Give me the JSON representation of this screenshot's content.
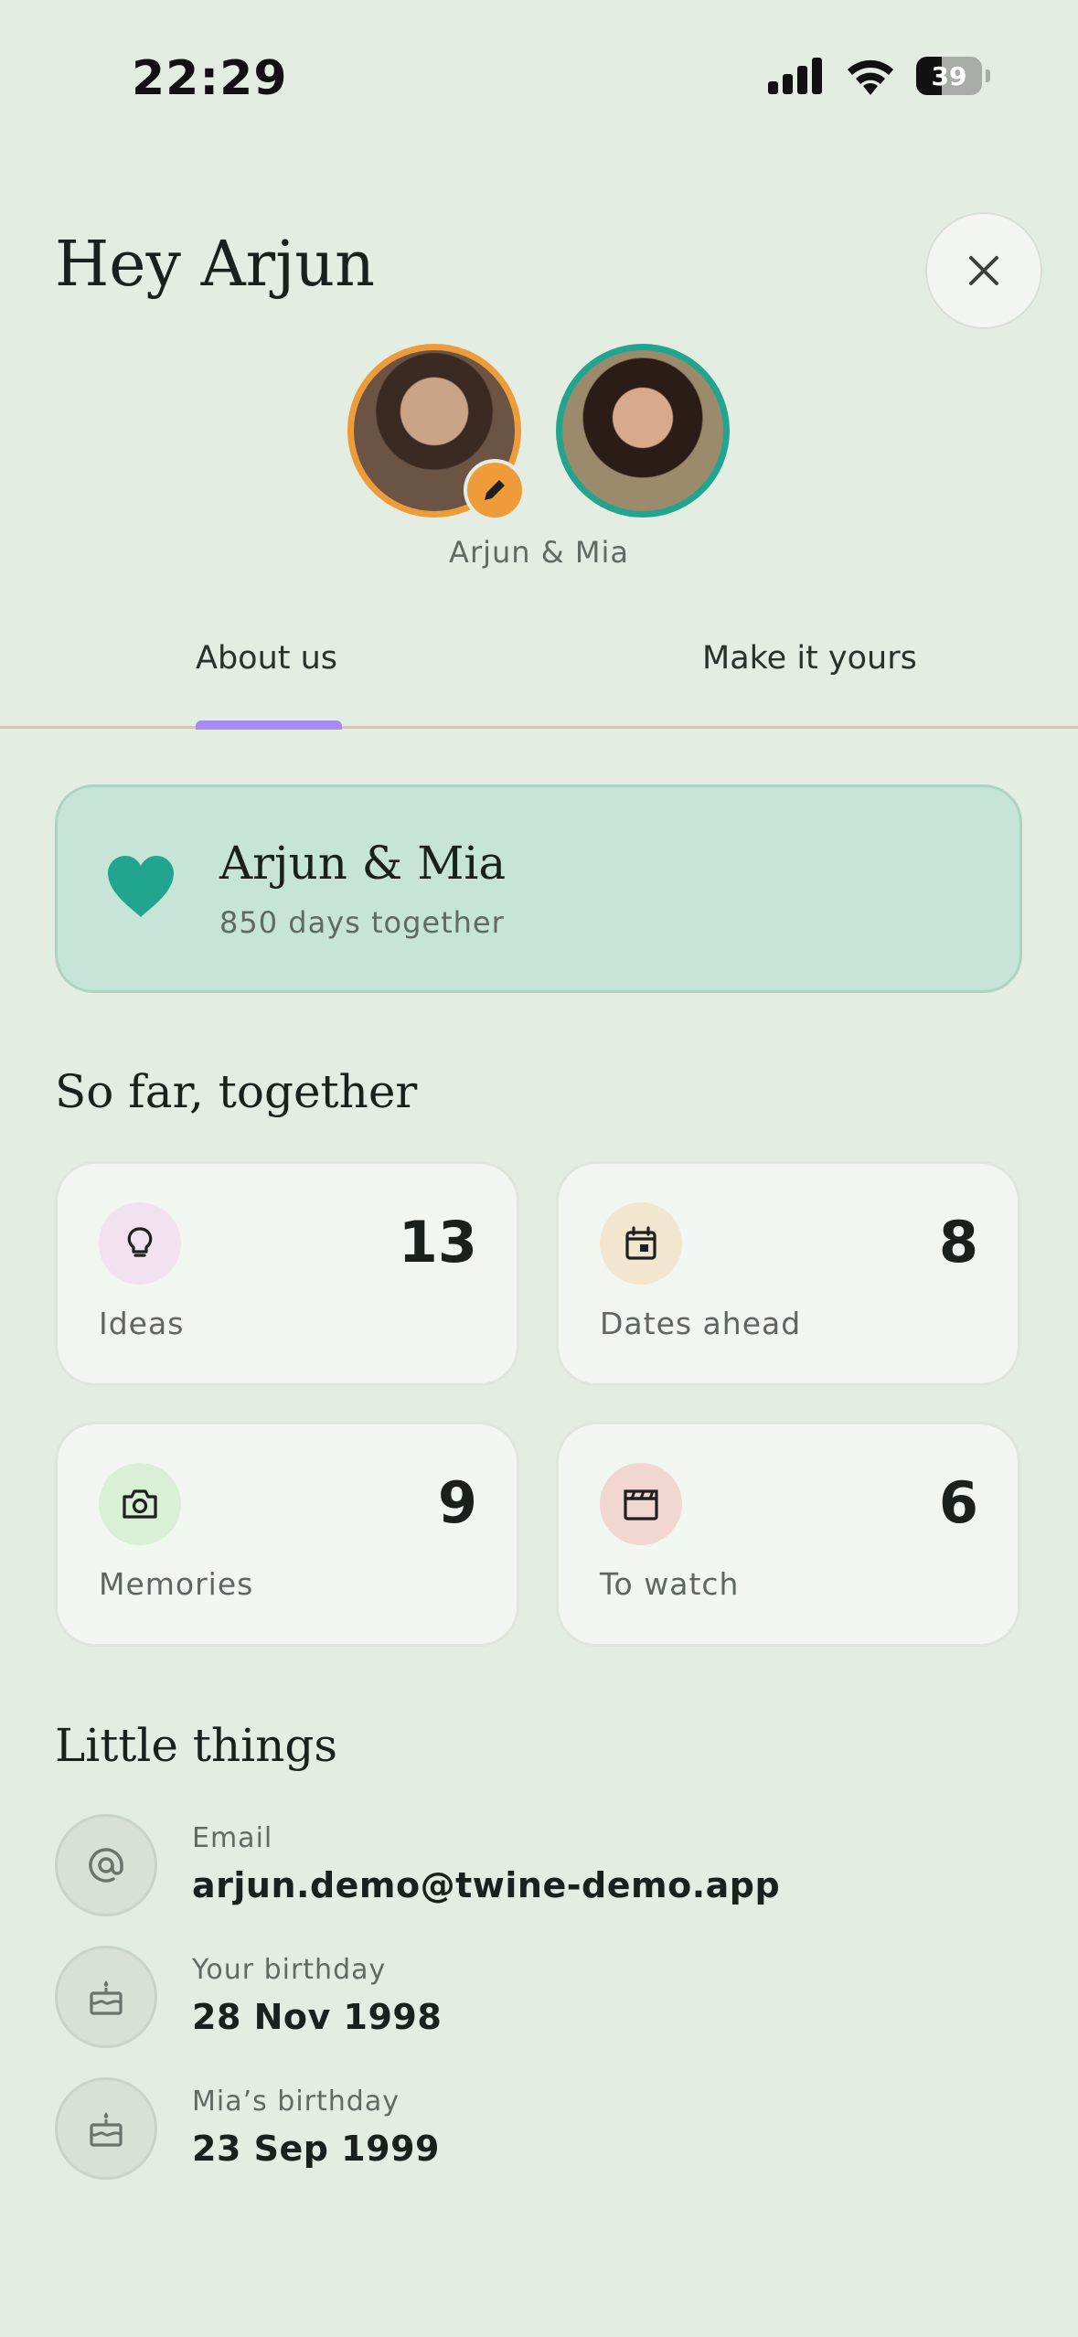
{
  "status_bar": {
    "time": "22:29",
    "battery": "39",
    "battery_level": 0.39
  },
  "header": {
    "greeting": "Hey Arjun",
    "couple_caption": "Arjun & Mia"
  },
  "tabs": [
    {
      "label": "About us",
      "active": true
    },
    {
      "label": "Make it yours",
      "active": false
    }
  ],
  "couple_card": {
    "names": "Arjun & Mia",
    "days": "850 days together"
  },
  "stats": {
    "title": "So far, together",
    "items": [
      {
        "label": "Ideas",
        "value": "13",
        "icon": "lightbulb-icon",
        "color": "#f2e2ef"
      },
      {
        "label": "Dates ahead",
        "value": "8",
        "icon": "calendar-icon",
        "color": "#f2e6cf"
      },
      {
        "label": "Memories",
        "value": "9",
        "icon": "camera-icon",
        "color": "#d9efd6"
      },
      {
        "label": "To watch",
        "value": "6",
        "icon": "clapperboard-icon",
        "color": "#f2d6d2"
      }
    ]
  },
  "little_things": {
    "title": "Little things",
    "items": [
      {
        "label": "Email",
        "value": "arjun.demo@twine-demo.app",
        "icon": "at-icon"
      },
      {
        "label": "Your birthday",
        "value": "28 Nov 1998",
        "icon": "cake-icon"
      },
      {
        "label": "Mia’s birthday",
        "value": "23 Sep 1999",
        "icon": "cake-icon"
      }
    ]
  },
  "colors": {
    "background": "#e4ede2",
    "accent_orange": "#ee9c3a",
    "accent_teal": "#21a58e",
    "tab_indicator": "#a78bf5"
  }
}
